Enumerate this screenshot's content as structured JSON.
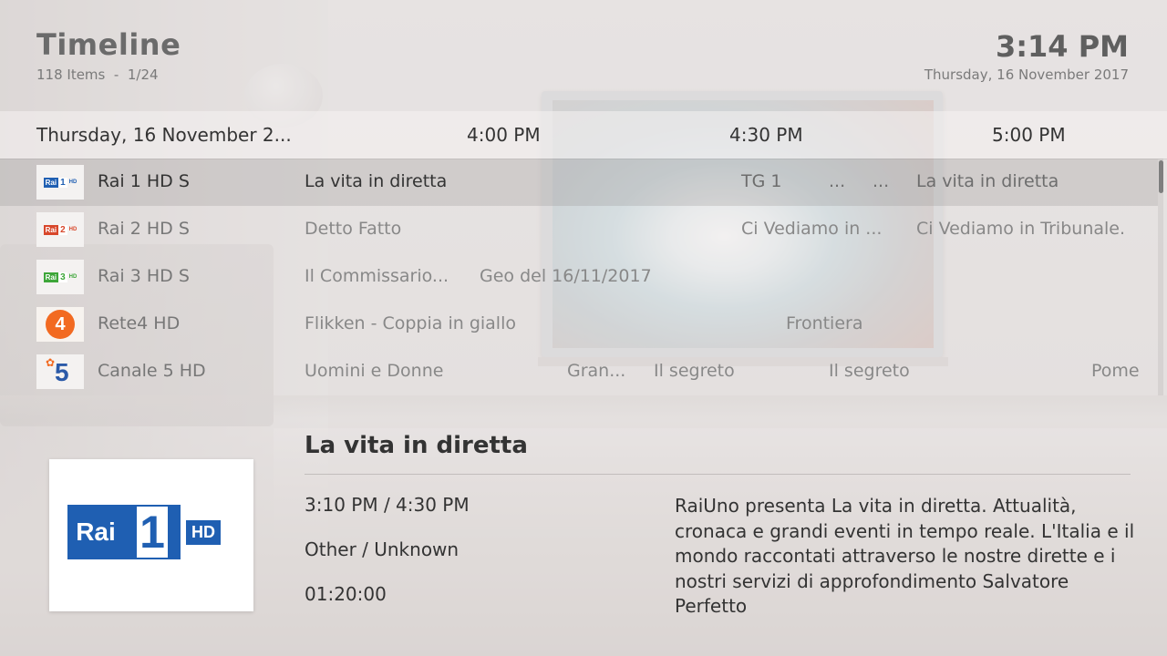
{
  "header": {
    "title": "Timeline",
    "subtitle": "118 Items  -  1/24",
    "clock": "3:14 PM",
    "date": "Thursday, 16 November 2017"
  },
  "timeline": {
    "date_label": "Thursday, 16 November 2...",
    "slots": [
      "4:00 PM",
      "4:30 PM",
      "5:00 PM"
    ]
  },
  "channels": [
    {
      "name": "Rai 1 HD S",
      "logo": {
        "text": "Rai",
        "number": "1",
        "suffix": "HD",
        "color": "#1f5fb2"
      },
      "selected": true,
      "programs": [
        "La vita in diretta",
        "TG 1",
        "...",
        "...",
        "La vita in diretta"
      ]
    },
    {
      "name": "Rai 2 HD S",
      "logo": {
        "text": "Rai",
        "number": "2",
        "suffix": "HD",
        "color": "#d8472b"
      },
      "selected": false,
      "programs": [
        "Detto Fatto",
        "Ci Vediamo in ...",
        "Ci Vediamo in Tribunale."
      ]
    },
    {
      "name": "Rai 3 HD S",
      "logo": {
        "text": "Rai",
        "number": "3",
        "suffix": "HD",
        "color": "#3da639"
      },
      "selected": false,
      "programs": [
        "Il Commissario...",
        "Geo del 16/11/2017"
      ]
    },
    {
      "name": "Rete4 HD",
      "logo": {
        "text": "4",
        "color": "#f26a21"
      },
      "selected": false,
      "programs": [
        "Flikken - Coppia in giallo",
        "Frontiera"
      ]
    },
    {
      "name": "Canale 5 HD",
      "logo": {
        "text": "5",
        "color": "#2b5aa8"
      },
      "selected": false,
      "programs": [
        "Uomini e Donne",
        "Gran...",
        "Il segreto",
        "Il segreto",
        "Pome"
      ]
    }
  ],
  "detail": {
    "title": "La vita in diretta",
    "time": "3:10 PM / 4:30 PM",
    "genre": "Other / Unknown",
    "duration": "01:20:00",
    "description": "RaiUno presenta La vita in diretta. Attualità, cronaca e grandi eventi in tempo reale. L'Italia e il mondo raccontati attraverso le nostre dirette e i nostri servizi di approfondimento Salvatore Perfetto",
    "logo": {
      "text": "Rai",
      "number": "1",
      "suffix": "HD",
      "color": "#1f5fb2"
    }
  },
  "scroll": {
    "position_fraction": 0.0
  }
}
